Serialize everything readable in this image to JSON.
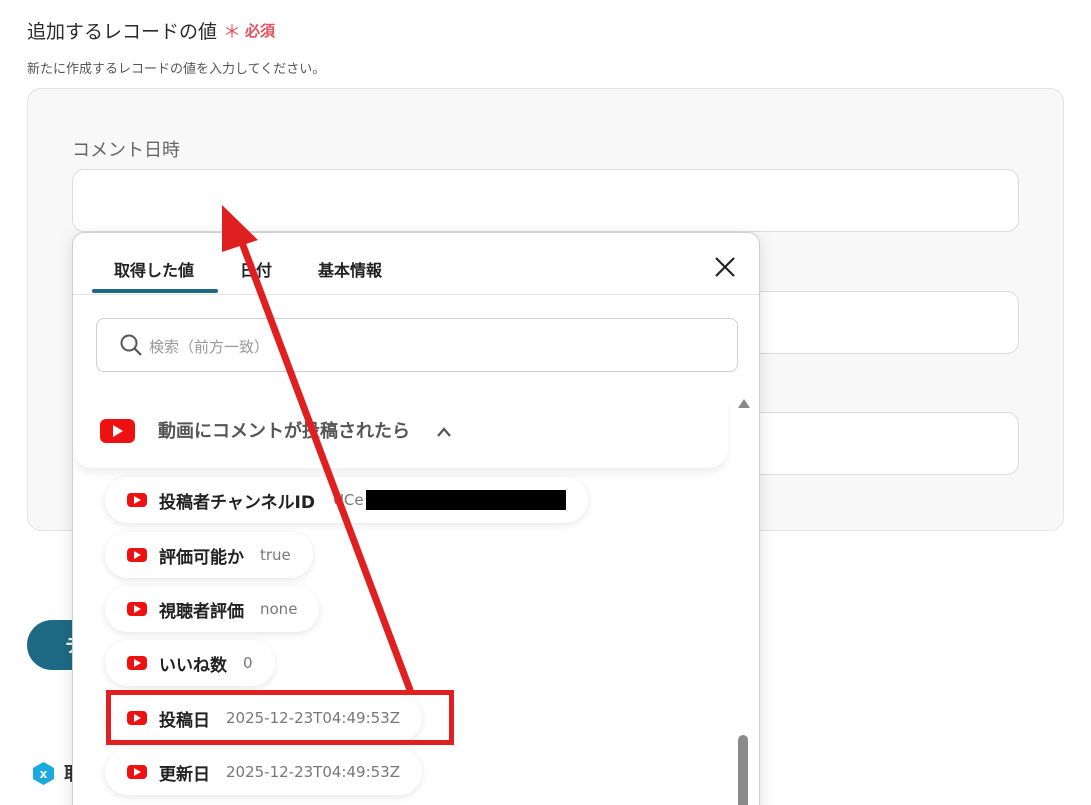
{
  "section": {
    "title": "追加するレコードの値",
    "required_mark": "＊",
    "required_text": "必須",
    "description": "新たに作成するレコードの値を入力してください。"
  },
  "fields": [
    {
      "label": "コメント日時",
      "value": ""
    },
    {
      "label": "",
      "value": ""
    },
    {
      "label": "",
      "value": ""
    }
  ],
  "bottom": {
    "test_button_partial": "テ",
    "partial_text": "取"
  },
  "popup": {
    "tabs": [
      {
        "label": "取得した値",
        "active": true
      },
      {
        "label": "日付",
        "active": false
      },
      {
        "label": "基本情報",
        "active": false
      }
    ],
    "search_placeholder": "検索（前方一致）",
    "group": {
      "icon": "youtube-icon",
      "title": "動画にコメントが投稿されたら",
      "expanded": true
    },
    "items": [
      {
        "label": "投稿者チャンネルID",
        "value": "UCe",
        "redacted": true
      },
      {
        "label": "評価可能か",
        "value": "true"
      },
      {
        "label": "視聴者評価",
        "value": "none"
      },
      {
        "label": "いいね数",
        "value": "0"
      },
      {
        "label": "投稿日",
        "value": "2025-12-23T04:49:53Z",
        "highlighted": true
      },
      {
        "label": "更新日",
        "value": "2025-12-23T04:49:53Z"
      }
    ]
  },
  "colors": {
    "accent": "#1e6a84",
    "required": "#e4525e",
    "youtube": "#ee1111",
    "annotation": "#e02020"
  }
}
